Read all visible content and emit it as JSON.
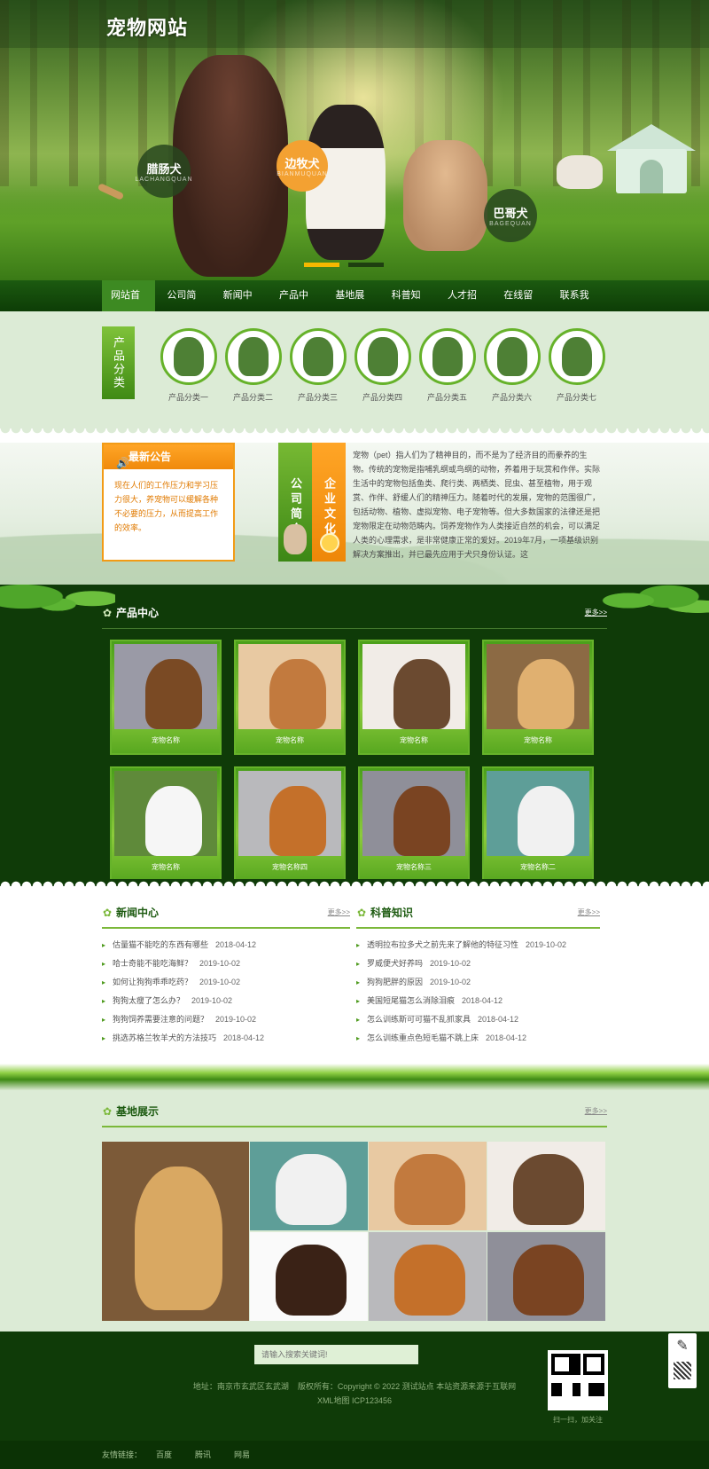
{
  "site": {
    "title": "宠物网站"
  },
  "hero": {
    "bubbles": [
      {
        "cn": "腊肠犬",
        "en": "LACHANGQUAN"
      },
      {
        "cn": "边牧犬",
        "en": "BIANMUQUAN"
      },
      {
        "cn": "巴哥犬",
        "en": "BAGEQUAN"
      }
    ]
  },
  "nav": {
    "items": [
      "网站首页",
      "公司简介",
      "新闻中心",
      "产品中心",
      "基地展示",
      "科普知识",
      "人才招聘",
      "在线留言",
      "联系我们"
    ]
  },
  "categories": {
    "tag": "产品分类",
    "items": [
      "产品分类一",
      "产品分类二",
      "产品分类三",
      "产品分类四",
      "产品分类五",
      "产品分类六",
      "产品分类七"
    ]
  },
  "notice": {
    "title": "最新公告",
    "body": "现在人们的工作压力和学习压力很大，养宠物可以缓解各种不必要的压力，从而提高工作的效率。"
  },
  "about": {
    "tab1": "公司简介",
    "tab2": "企业文化",
    "text": "宠物（pet）指人们为了精神目的，而不是为了经济目的而豢养的生物。传统的宠物是指哺乳纲或鸟纲的动物，养着用于玩赏和作伴。实际生活中的宠物包括鱼类、爬行类、两栖类、昆虫、甚至植物，用于观赏、作伴、舒缓人们的精神压力。随着时代的发展，宠物的范围很广，包括动物、植物、虚拟宠物、电子宠物等。但大多数国家的法律还是把宠物限定在动物范畴内。饲养宠物作为人类接近自然的机会，可以满足人类的心理需求，是非常健康正常的爱好。2019年7月，一项基级识别解决方案推出，并已最先应用于犬只身份认证。这"
  },
  "products": {
    "title": "产品中心",
    "more": "更多>>",
    "items": [
      {
        "name": "宠物名称",
        "bg": "#9a9aa6",
        "dog": "#7a4a24"
      },
      {
        "name": "宠物名称",
        "bg": "#e8c9a2",
        "dog": "#c27a3e"
      },
      {
        "name": "宠物名称",
        "bg": "#f1ece7",
        "dog": "#6b4a30"
      },
      {
        "name": "宠物名称",
        "bg": "#8c6a44",
        "dog": "#e0b070"
      },
      {
        "name": "宠物名称",
        "bg": "#5f8a3a",
        "dog": "#f6f6f6"
      },
      {
        "name": "宠物名称四",
        "bg": "#b9b9bc",
        "dog": "#c4702a"
      },
      {
        "name": "宠物名称三",
        "bg": "#8f8f99",
        "dog": "#7a4422"
      },
      {
        "name": "宠物名称二",
        "bg": "#5e9e98",
        "dog": "#f1f1f1"
      }
    ]
  },
  "news": {
    "title": "新闻中心",
    "more": "更多>>",
    "items": [
      {
        "text": "估量猫不能吃的东西有哪些",
        "date": "2018-04-12"
      },
      {
        "text": "哈士奇能不能吃海鲜？",
        "date": "2019-10-02"
      },
      {
        "text": "如何让狗狗乖乖吃药？",
        "date": "2019-10-02"
      },
      {
        "text": "狗狗太瘦了怎么办？",
        "date": "2019-10-02"
      },
      {
        "text": "狗狗饲养需要注意的问题？",
        "date": "2019-10-02"
      },
      {
        "text": "挑选苏格兰牧羊犬的方法技巧",
        "date": "2018-04-12"
      }
    ]
  },
  "science": {
    "title": "科普知识",
    "more": "更多>>",
    "items": [
      {
        "text": "透明拉布拉多犬之前先来了解他的特征习性",
        "date": "2019-10-02"
      },
      {
        "text": "罗威便犬好养吗",
        "date": "2019-10-02"
      },
      {
        "text": "狗狗肥胖的原因",
        "date": "2019-10-02"
      },
      {
        "text": "美国短尾猫怎么消除泪痕",
        "date": "2018-04-12"
      },
      {
        "text": "怎么训练斯可可猫不乱抓家具",
        "date": "2018-04-12"
      },
      {
        "text": "怎么训练重点色短毛猫不跳上床",
        "date": "2018-04-12"
      }
    ]
  },
  "base": {
    "title": "基地展示",
    "more": "更多>>",
    "tiles": [
      {
        "bg": "#7c5a38",
        "dog": "#d9a862"
      },
      {
        "bg": "#5e9e98",
        "dog": "#f1f1f1"
      },
      {
        "bg": "#e8c9a2",
        "dog": "#c27a3e"
      },
      {
        "bg": "#f1ece7",
        "dog": "#6b4a30"
      },
      {
        "bg": "#fafafa",
        "dog": "#3a2216"
      },
      {
        "bg": "#b9b9bc",
        "dog": "#c4702a"
      },
      {
        "bg": "#8f8f99",
        "dog": "#7a4422"
      }
    ]
  },
  "footer": {
    "search_placeholder": "请输入搜索关键词!",
    "address": "地址：南京市玄武区玄武湖",
    "copyright": "版权所有：Copyright © 2022 测试站点 本站资源来源于互联网",
    "icp": "XML地图 ICP123456",
    "qr_caption": "扫一扫，加关注"
  },
  "links": {
    "label": "友情链接：",
    "items": [
      "百度",
      "腾讯",
      "网易"
    ]
  }
}
